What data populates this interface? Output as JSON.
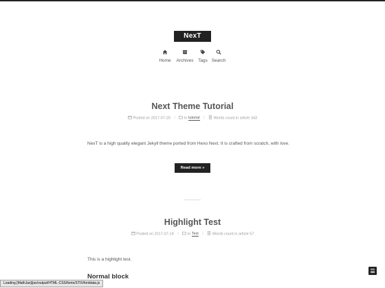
{
  "site": {
    "brand": "NexT"
  },
  "menu": [
    {
      "label": "Home",
      "icon": "home-icon"
    },
    {
      "label": "Archives",
      "icon": "archive-icon"
    },
    {
      "label": "Tags",
      "icon": "tags-icon"
    },
    {
      "label": "Search",
      "icon": "search-icon"
    }
  ],
  "posts": [
    {
      "title": "Next Theme Tutorial",
      "posted_on": "Posted on 2017-07-20",
      "in_label": "In",
      "category": "tutorial",
      "word_count": "Words count in article 343",
      "excerpt": "NexT is a high quality elegant Jekyll theme ported from Hexo Next. It is crafted from scratch, with love.",
      "read_more": "Read more »"
    },
    {
      "title": "Highlight Test",
      "posted_on": "Posted on 2017-07-19",
      "in_label": "In",
      "category": "Test",
      "word_count": "Words count in article 57",
      "excerpt": "This is a highlight test.",
      "section_heading": "Normal block"
    }
  ],
  "status_bar": {
    "text": "Loading [MathJax]/jax/output/HTML-CSS/fonts/STIX/fontdata.js"
  },
  "colors": {
    "brand_bg": "#222222",
    "text": "#555555",
    "meta": "#999999",
    "status_bg": "#e6e6e6"
  }
}
